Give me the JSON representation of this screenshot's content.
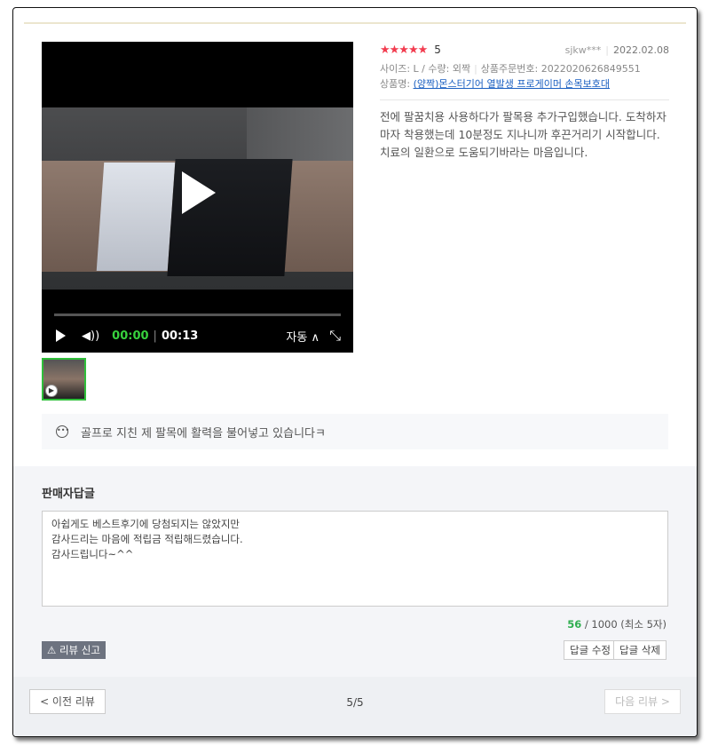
{
  "review": {
    "stars": "★★★★★",
    "score": "5",
    "user": "sjkw***",
    "date": "2022.02.08",
    "size_label": "사이즈: L / 수량: 외짝",
    "order_label": "상품주문번호: 2022020626849551",
    "product_prefix": "상품명: ",
    "product_name": "(양짝)몬스터기어 열발생 프로게이머 손목보호대",
    "body": "전에 팔꿈치용 사용하다가 팔목용 추가구입했습니다. 도착하자마자 착용했는데 10분정도 지나니까 후끈거리기 시작합니다. 치료의 일환으로 도움되기바라는 마음입니다."
  },
  "video": {
    "current_time": "00:00",
    "total_time": "00:13",
    "auto_label": "자동 ∧",
    "play_icon": "play-icon",
    "volume_icon": "volume-icon",
    "fullscreen_icon": "fullscreen-icon"
  },
  "comment": {
    "text": "골프로 지친 제 팔목에 활력을 불어넣고 있습니다ㅋ"
  },
  "seller_reply": {
    "title": "판매자답글",
    "text": "아쉽게도 베스트후기에 당첨되지는 않았지만\n감사드리는 마음에 적립금 적립해드렸습니다.\n감사드립니다~^^",
    "count": "56",
    "count_rest": " / 1000 (최소 5자)",
    "report_label": "⚠ 리뷰 신고",
    "edit_label": "답글 수정",
    "delete_label": "답글 삭제"
  },
  "pager": {
    "prev": "< 이전 리뷰",
    "page": "5/5",
    "next": "다음 리뷰 >"
  }
}
